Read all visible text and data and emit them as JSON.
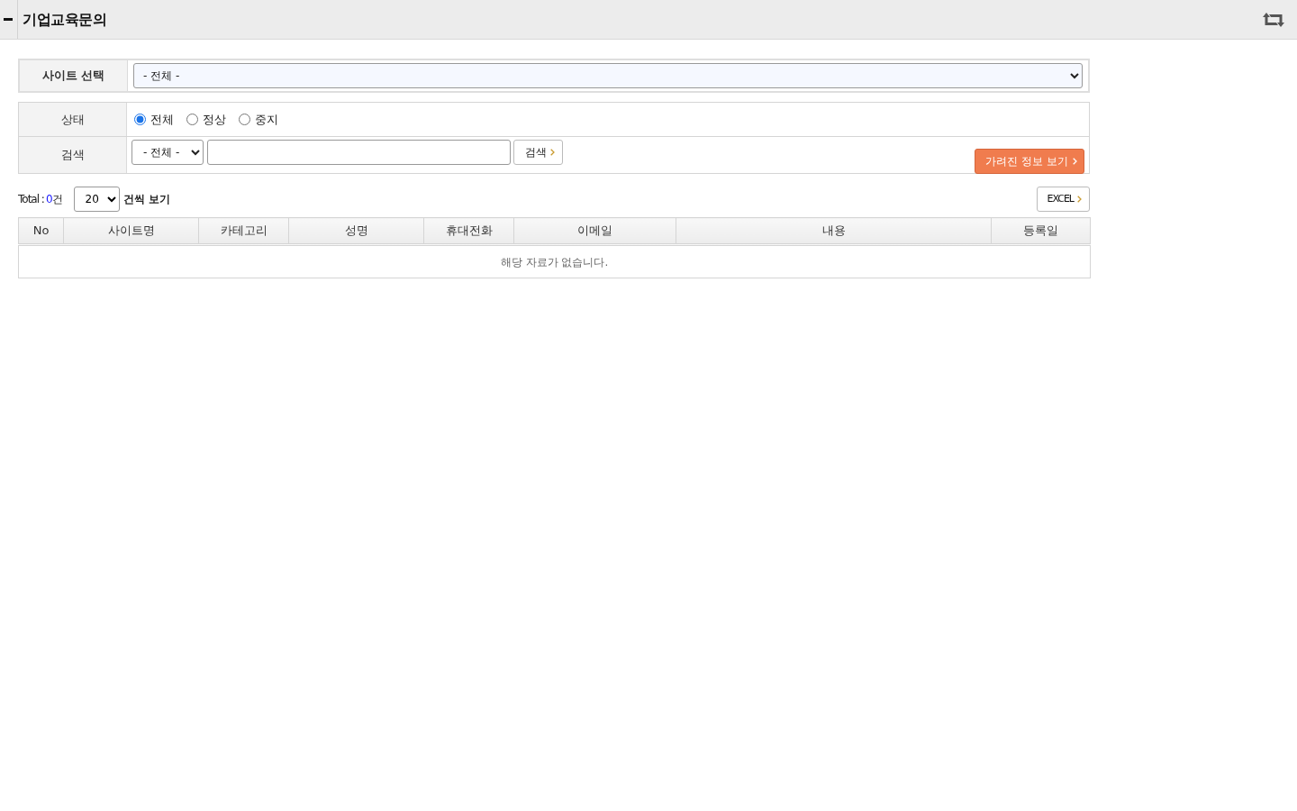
{
  "header": {
    "title": "기업교육문의"
  },
  "site_select": {
    "label": "사이트 선택",
    "value": "- 전체 -"
  },
  "filters": {
    "status": {
      "label": "상태",
      "options": [
        {
          "label": "전체",
          "selected": true
        },
        {
          "label": "정상",
          "selected": false
        },
        {
          "label": "중지",
          "selected": false
        }
      ]
    },
    "search": {
      "label": "검색",
      "field": "- 전체 -",
      "button": "검색"
    },
    "hidden_info_button": "가려진 정보 보기"
  },
  "list_controls": {
    "total_label": "Total :",
    "total_count": "0",
    "total_unit": "건",
    "page_size": "20",
    "page_size_suffix": "건씩 보기",
    "excel_button": "EXCEL"
  },
  "table": {
    "columns": [
      "No",
      "사이트명",
      "카테고리",
      "성명",
      "휴대전화",
      "이메일",
      "내용",
      "등록일"
    ],
    "empty_message": "해당 자료가 없습니다."
  }
}
